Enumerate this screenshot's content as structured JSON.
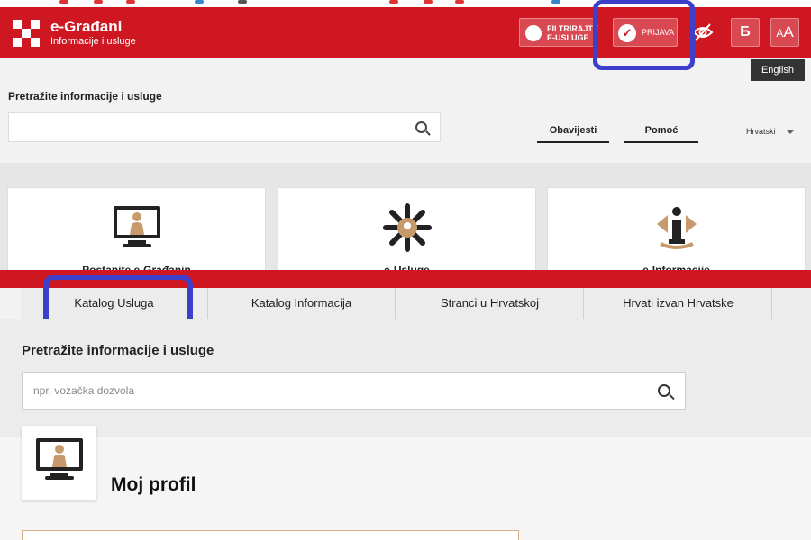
{
  "header": {
    "brand_title": "e-Građani",
    "brand_subtitle": "Informacije i usluge",
    "filter_line1": "FILTRIRAJTE",
    "filter_line2": "E-USLUGE",
    "login_label": "PRIJAVA",
    "font_size_label_small": "A",
    "font_size_label_large": "A",
    "script_toggle_label": "Б",
    "english_label": "English",
    "brand_color": "#cf1722"
  },
  "search_top": {
    "label": "Pretražite informacije i usluge",
    "value": "",
    "placeholder": ""
  },
  "nav": {
    "obavijesti": "Obavijesti",
    "pomoc": "Pomoć",
    "language": "Hrvatski"
  },
  "cards": [
    {
      "label": "Postanite e-Građanin",
      "icon": "monitor-person-icon"
    },
    {
      "label": "e-Usluge",
      "icon": "gear-hands-icon"
    },
    {
      "label": "e-Informacije",
      "icon": "info-person-icon"
    }
  ],
  "tabs": [
    {
      "label": "Katalog Usluga"
    },
    {
      "label": "Katalog Informacija"
    },
    {
      "label": "Stranci u Hrvatskoj"
    },
    {
      "label": "Hrvati izvan Hrvatske"
    }
  ],
  "search_main": {
    "label": "Pretražite informacije i usluge",
    "placeholder": "npr. vozačka dozvola",
    "value": ""
  },
  "profile": {
    "title": "Moj profil"
  },
  "highlight_color": "#3c3fc9"
}
